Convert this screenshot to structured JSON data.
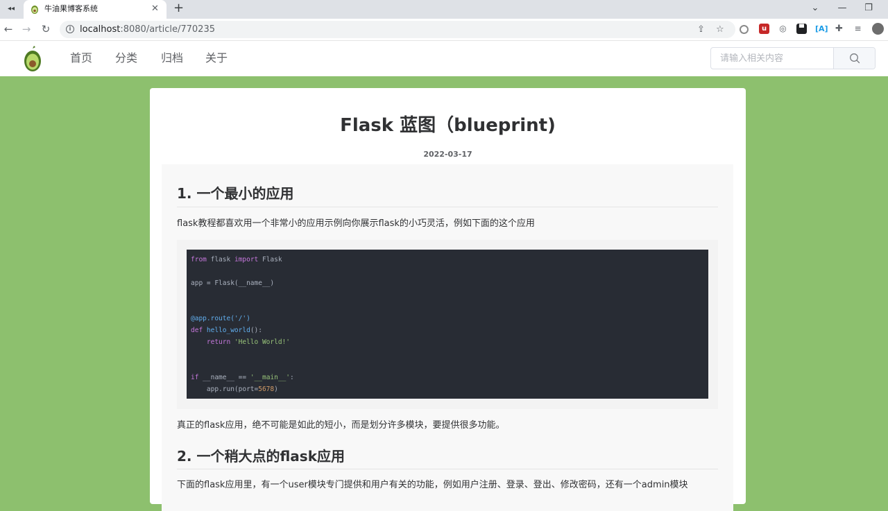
{
  "browser": {
    "tab_title": "牛油果博客系统",
    "url_host": "localhost",
    "url_path": ":8080/article/770235"
  },
  "site": {
    "nav": [
      "首页",
      "分类",
      "归档",
      "关于"
    ],
    "search_placeholder": "请输入相关内容"
  },
  "article": {
    "title": "Flask 蓝图（blueprint)",
    "date": "2022-03-17",
    "section1_heading": "1. 一个最小的应用",
    "section1_para": "flask教程都喜欢用一个非常小的应用示例向你展示flask的小巧灵活，例如下面的这个应用",
    "code": {
      "l1_kw1": "from",
      "l1_mid": " flask ",
      "l1_kw2": "import",
      "l1_end": " Flask",
      "l2": "app = Flask(__name__)",
      "l3": "@app.route('/')",
      "l4_kw": "def",
      "l4_fn": " hello_world",
      "l4_end": "():",
      "l5_kw": "    return",
      "l5_str": " 'Hello World!'",
      "l6_kw": "if",
      "l6_mid": " __name__ == ",
      "l6_str": "'__main__'",
      "l6_end": ":",
      "l7_a": "    app.run(port=",
      "l7_num": "5678",
      "l7_b": ")"
    },
    "section1_after": "真正的flask应用，绝不可能是如此的短小，而是划分许多模块，要提供很多功能。",
    "section2_heading": "2. 一个稍大点的flask应用",
    "section2_para": "下面的flask应用里，有一个user模块专门提供和用户有关的功能，例如用户注册、登录、登出、修改密码，还有一个admin模块"
  }
}
